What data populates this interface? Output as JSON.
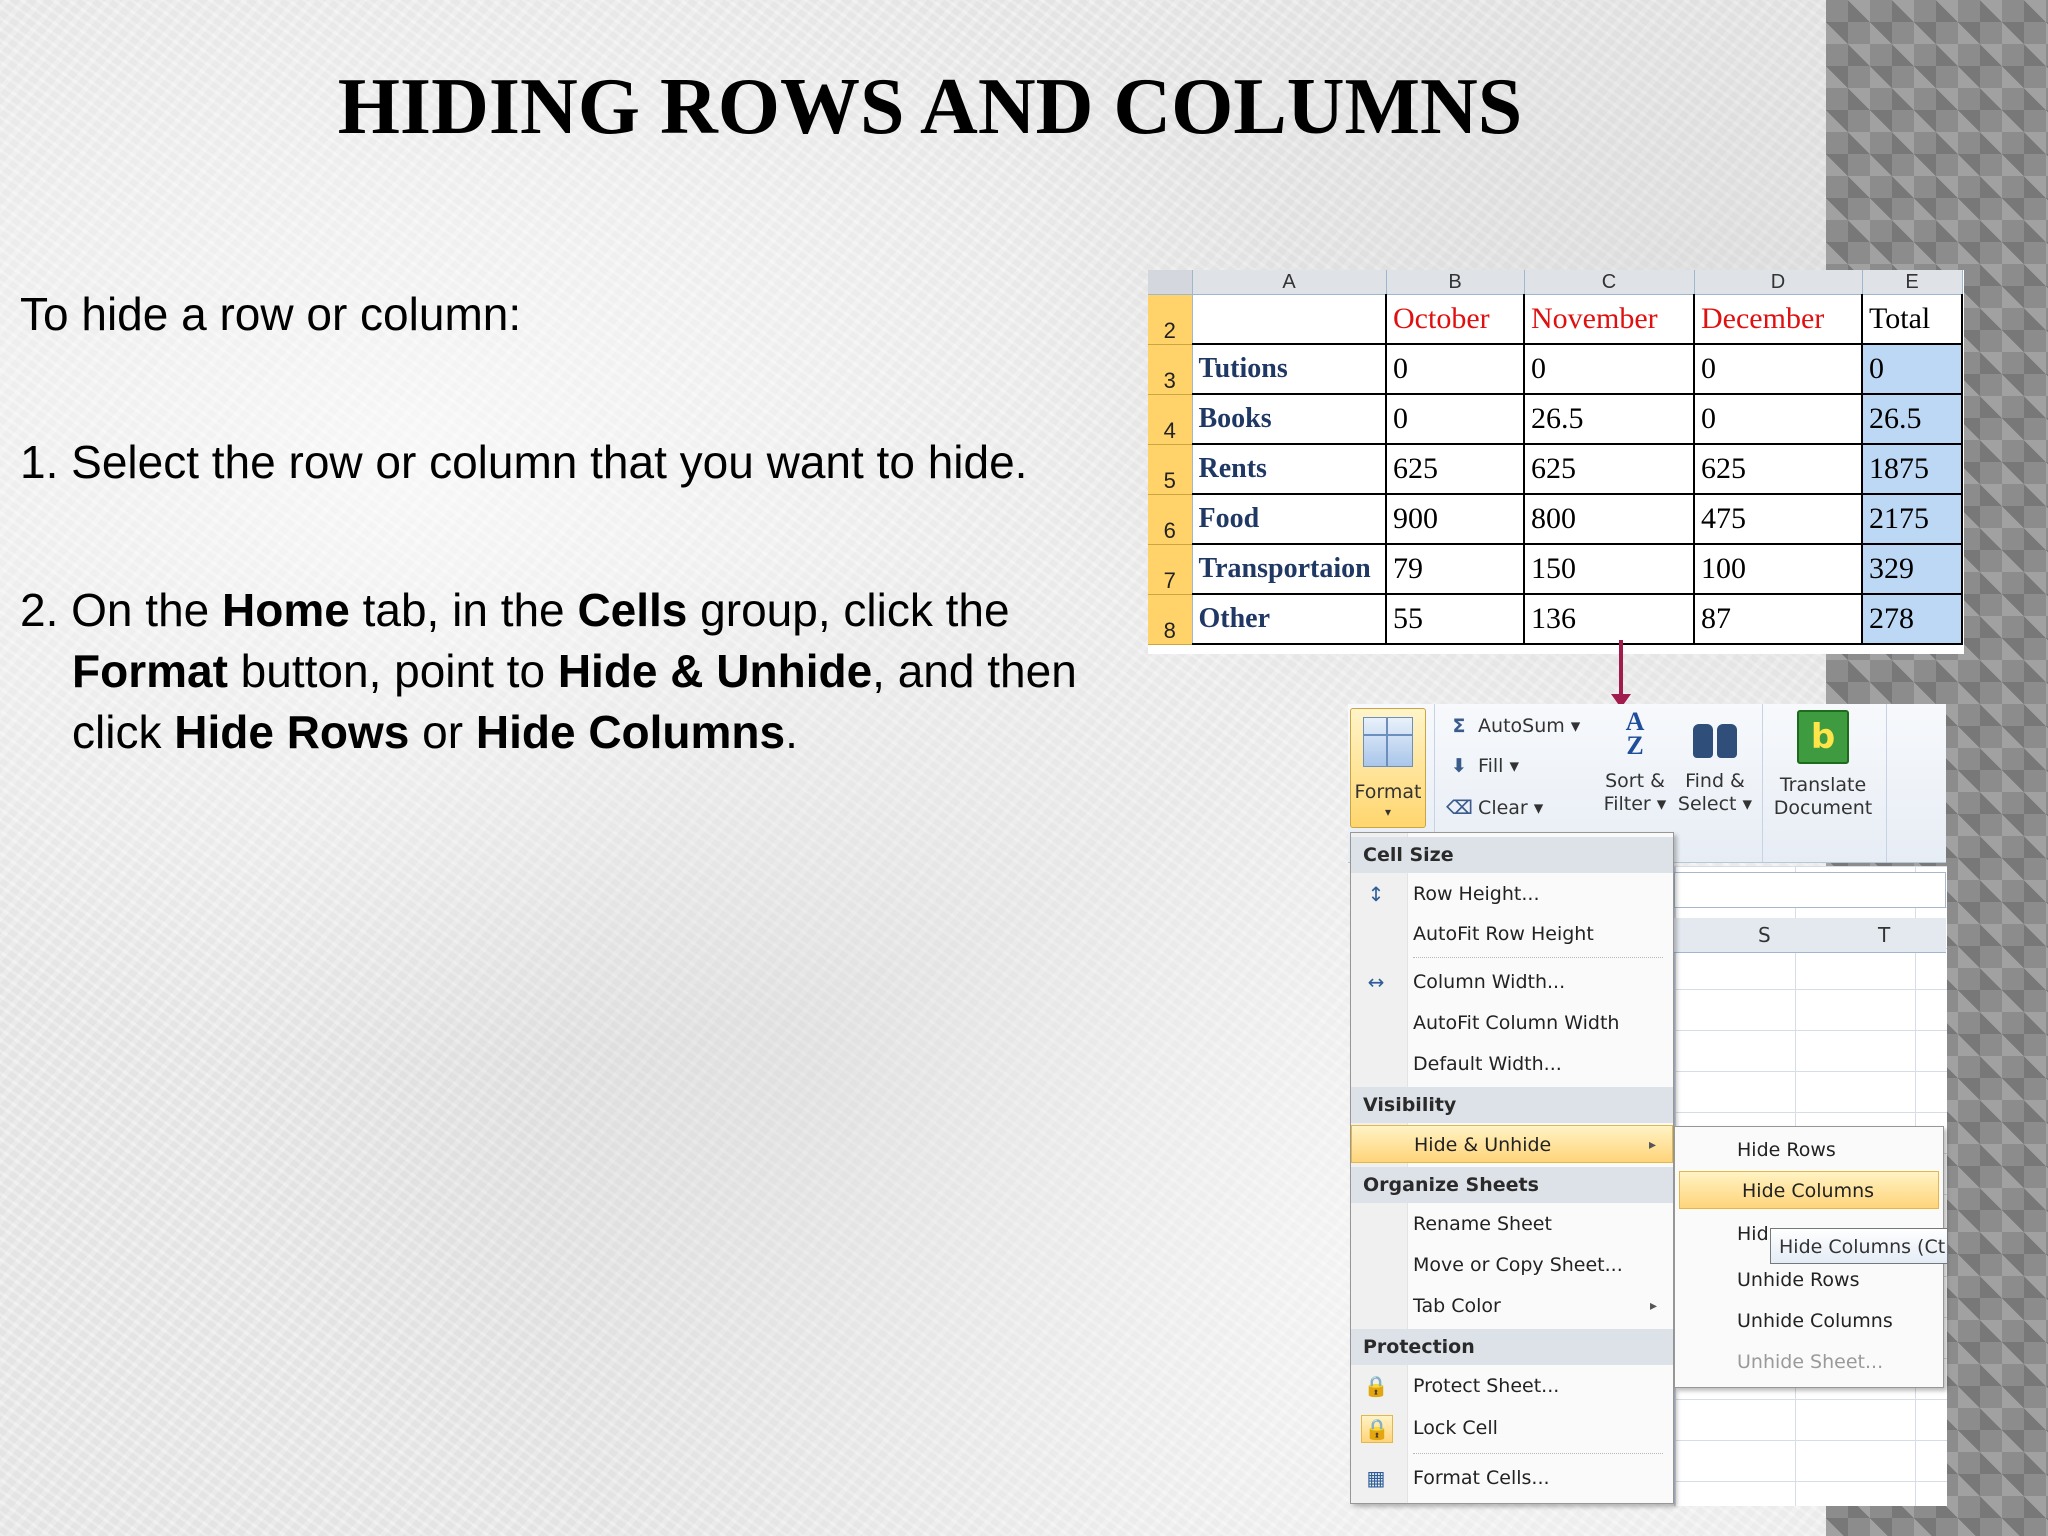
{
  "slide": {
    "title": "HIDING ROWS AND COLUMNS",
    "intro": "To hide a row or column:",
    "step1": "1. Select the row or column that you want to hide.",
    "step2": {
      "t1": "2. On the ",
      "b1": "Home",
      "t2": " tab, in the ",
      "b2": "Cells",
      "t3": " group, click the ",
      "b3": "Format",
      "t4": " button, point to ",
      "b4": "Hide & Unhide",
      "t5": ", and then click ",
      "b5": "Hide Rows",
      "t6": " or ",
      "b6": "Hide Columns",
      "t7": "."
    }
  },
  "spreadsheet": {
    "column_headers": [
      "A",
      "B",
      "C",
      "D",
      "E"
    ],
    "header_row": {
      "row": "2",
      "cells": [
        "",
        "October",
        "November",
        "December",
        "Total"
      ]
    },
    "rows": [
      {
        "row": "3",
        "cells": [
          "Tutions",
          "0",
          "0",
          "0",
          "0"
        ]
      },
      {
        "row": "4",
        "cells": [
          "Books",
          "0",
          "26.5",
          "0",
          "26.5"
        ]
      },
      {
        "row": "5",
        "cells": [
          "Rents",
          "625",
          "625",
          "625",
          "1875"
        ]
      },
      {
        "row": "6",
        "cells": [
          "Food",
          "900",
          "800",
          "475",
          "2175"
        ]
      },
      {
        "row": "7",
        "cells": [
          "Transportaion",
          "79",
          "150",
          "100",
          "329"
        ]
      },
      {
        "row": "8",
        "cells": [
          "Other",
          "55",
          "136",
          "87",
          "278"
        ]
      }
    ]
  },
  "ribbon": {
    "format_label": "Format",
    "format_arrow": "▾",
    "autosum": "AutoSum ▾",
    "fill": "Fill ▾",
    "clear": "Clear ▾",
    "sort_filter_1": "Sort &",
    "sort_filter_2": "Filter ▾",
    "find_select_1": "Find &",
    "find_select_2": "Select ▾",
    "translate_1": "Translate",
    "translate_2": "Document",
    "sigma": "Σ",
    "sort_glyph_a": "A",
    "sort_glyph_z": "Z",
    "translate_glyph": "b"
  },
  "grid": {
    "columns": [
      "S",
      "T"
    ]
  },
  "format_menu": {
    "cell_size": "Cell Size",
    "row_height": "Row Height...",
    "autofit_row_height": "AutoFit Row Height",
    "column_width": "Column Width...",
    "autofit_column_width": "AutoFit Column Width",
    "default_width": "Default Width...",
    "visibility": "Visibility",
    "hide_unhide": "Hide & Unhide",
    "organize_sheets": "Organize Sheets",
    "rename_sheet": "Rename Sheet",
    "move_copy_sheet": "Move or Copy Sheet...",
    "tab_color": "Tab Color",
    "protection": "Protection",
    "protect_sheet": "Protect Sheet...",
    "lock_cell": "Lock Cell",
    "format_cells": "Format Cells...",
    "submenu_arrow": "▸"
  },
  "hide_submenu": {
    "hide_rows": "Hide Rows",
    "hide_columns": "Hide Columns",
    "hide_sheet_partial": "Hid",
    "unhide_rows": "Unhide Rows",
    "unhide_columns": "Unhide Columns",
    "unhide_sheet": "Unhide Sheet..."
  },
  "tooltip": "Hide Columns (Ct",
  "colors": {
    "accent_red": "#e01010",
    "selection_blue": "#bcd8f4",
    "highlight_gold": "#ffd47a",
    "arrow": "#a11b4c"
  }
}
